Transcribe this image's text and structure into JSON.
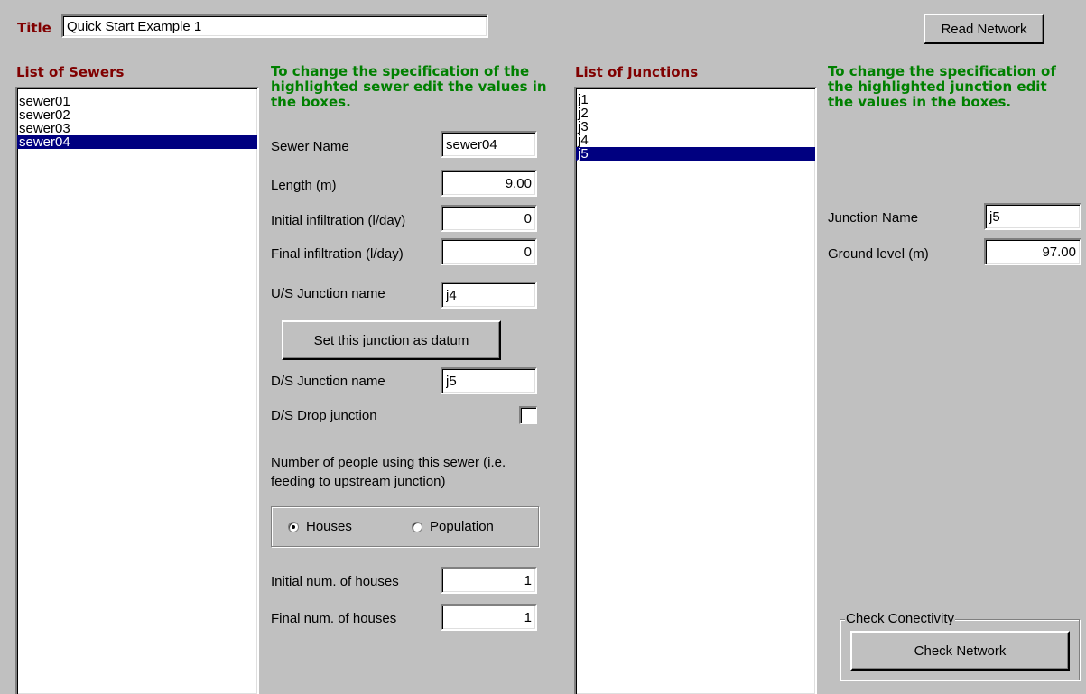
{
  "header": {
    "title_label": "Title",
    "title_value": "Quick Start Example 1",
    "read_network_label": "Read Network"
  },
  "sewers": {
    "heading": "List of Sewers",
    "items": [
      {
        "label": "sewer01",
        "selected": false
      },
      {
        "label": "sewer02",
        "selected": false
      },
      {
        "label": "sewer03",
        "selected": false
      },
      {
        "label": "sewer04",
        "selected": true
      }
    ]
  },
  "sewer_spec": {
    "instructions": "To change the specification of the highlighted sewer edit the values in the boxes.",
    "name_label": "Sewer Name",
    "name_value": "sewer04",
    "length_label": "Length (m)",
    "length_value": "9.00",
    "init_infil_label": "Initial infiltration (l/day)",
    "init_infil_value": "0",
    "final_infil_label": "Final infiltration (l/day)",
    "final_infil_value": "0",
    "us_label": "U/S Junction name",
    "us_value": "j4",
    "datum_button": "Set this junction as datum",
    "ds_label": "D/S Junction name",
    "ds_value": "j5",
    "drop_label": "D/S Drop junction",
    "drop_checked": false,
    "people_text": "Number of people using this sewer (i.e. feeding to upstream junction)",
    "radio_houses": "Houses",
    "radio_population": "Population",
    "radio_selected": "Houses",
    "init_houses_label": "Initial num. of houses",
    "init_houses_value": "1",
    "final_houses_label": "Final num. of houses",
    "final_houses_value": "1"
  },
  "junctions": {
    "heading": "List of Junctions",
    "items": [
      {
        "label": "j1",
        "selected": false
      },
      {
        "label": "j2",
        "selected": false
      },
      {
        "label": "j3",
        "selected": false
      },
      {
        "label": "j4",
        "selected": false
      },
      {
        "label": "j5",
        "selected": true
      }
    ]
  },
  "junction_spec": {
    "instructions": "To change the specification of the highlighted junction edit the values in the boxes.",
    "name_label": "Junction Name",
    "name_value": "j5",
    "ground_label": "Ground level (m)",
    "ground_value": "97.00"
  },
  "connectivity": {
    "group_label": "Check Conectivity",
    "button_label": "Check Network"
  },
  "colors": {
    "background": "#c0c0c0",
    "heading_red": "#800000",
    "instruction_green": "#008000",
    "selection": "#000080"
  }
}
